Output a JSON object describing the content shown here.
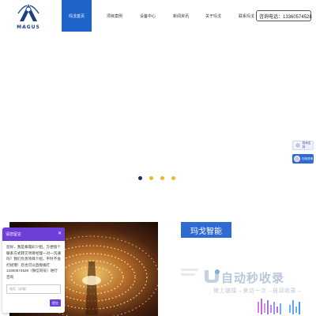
{
  "header": {
    "logo_text": "MAGUS",
    "nav": [
      {
        "label": "玛戈首页",
        "active": true
      },
      {
        "label": "项目案例",
        "active": false
      },
      {
        "label": "设备中心",
        "active": false
      },
      {
        "label": "新闻资讯",
        "active": false
      },
      {
        "label": "关于玛戈",
        "active": false
      },
      {
        "label": "联系玛戈",
        "active": false
      }
    ],
    "phone": "咨询电话：13360574528"
  },
  "carousel": {
    "dots": [
      "#1d2a5c",
      "#f2b731",
      "#f2b731",
      "#f2b731"
    ]
  },
  "side_buttons": [
    {
      "label": "技术支持"
    },
    {
      "label": "在线咨询"
    }
  ],
  "content": {
    "tag": "玛戈智能"
  },
  "watermark": {
    "main": "自动秒收录",
    "sub": "做上链接→来访一次→自动收录→"
  },
  "chat": {
    "title": "请您留言",
    "close": "✕",
    "message": "您好，我是秦霞彩少姐，方便留个联系方式转交项目经理一对一沟通吗？我们负责项目介绍，平时不会打扰哦！您也可以直接拨打13360574528（微信同号）进行咨询",
    "input_placeholder": "电话（必填）",
    "send": "提交"
  },
  "colors": {
    "brand_blue": "#1e63c8",
    "tag_blue": "#2f6bd0",
    "chat_purple": "#6d3fd8"
  }
}
